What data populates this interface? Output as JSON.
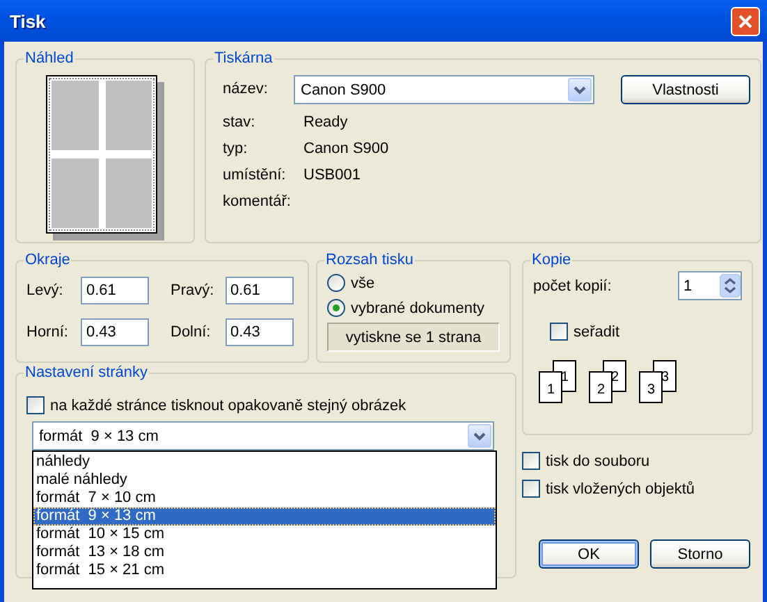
{
  "window": {
    "title": "Tisk"
  },
  "preview": {
    "title": "Náhled"
  },
  "printer": {
    "title": "Tiskárna",
    "name_label": "název:",
    "name_value": "Canon S900",
    "properties_button": "Vlastnosti",
    "details": [
      {
        "label": "stav:",
        "value": "Ready"
      },
      {
        "label": "typ:",
        "value": "Canon S900"
      },
      {
        "label": "umístění:",
        "value": "USB001"
      },
      {
        "label": "komentář:"
      }
    ]
  },
  "margins": {
    "title": "Okraje",
    "fields": [
      {
        "label": "Levý:",
        "value": "0.61"
      },
      {
        "label": "Pravý:",
        "value": "0.61"
      },
      {
        "label": "Horní:",
        "value": "0.43"
      },
      {
        "label": "Dolní:",
        "value": "0.43"
      }
    ]
  },
  "print_range": {
    "title": "Rozsah tisku",
    "options": [
      {
        "label": "vše",
        "selected": false
      },
      {
        "label": "vybrané dokumenty",
        "selected": true
      }
    ],
    "summary": "vytiskne se 1 strana"
  },
  "copies": {
    "title": "Kopie",
    "count_label": "počet kopií:",
    "count": "1",
    "collate": {
      "label": "seřadit",
      "checked": false
    },
    "collate_sets": [
      {
        "back": "1",
        "front": "1"
      },
      {
        "back": "2",
        "front": "2"
      },
      {
        "back": "3",
        "front": "3"
      }
    ]
  },
  "page_setup": {
    "title": "Nastavení stránky",
    "repeat_image": {
      "label": "na každé stránce tisknout opakovaně stejný obrázek",
      "checked": false
    },
    "layout": {
      "value": "formát  9 × 13 cm",
      "expanded": true,
      "options": [
        {
          "label": "náhledy",
          "selected": false
        },
        {
          "label": "malé náhledy",
          "selected": false
        },
        {
          "label": "formát  7 × 10 cm",
          "selected": false
        },
        {
          "label": "formát  9 × 13 cm",
          "selected": true
        },
        {
          "label": "formát  10 × 15 cm",
          "selected": false
        },
        {
          "label": "formát  13 × 18 cm",
          "selected": false
        },
        {
          "label": "formát  15 × 21 cm",
          "selected": false
        }
      ]
    }
  },
  "options": [
    {
      "label": "tisk do souboru",
      "checked": false
    },
    {
      "label": "tisk vložených objektů",
      "checked": false
    }
  ],
  "buttons": [
    {
      "label": "OK",
      "default": true
    },
    {
      "label": "Storno",
      "default": false
    }
  ]
}
